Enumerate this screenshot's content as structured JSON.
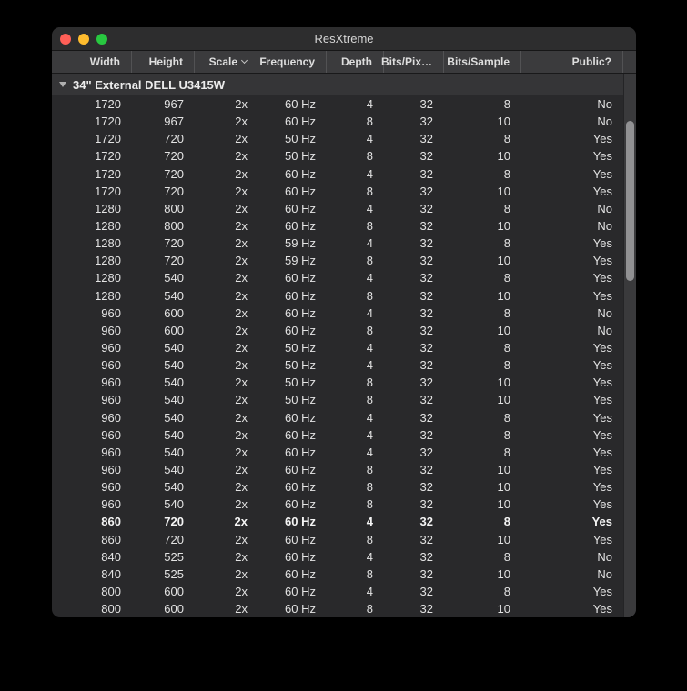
{
  "window": {
    "title": "ResXtreme"
  },
  "titlebar": {
    "traffic_lights": [
      {
        "name": "close",
        "color": "#ff5f57"
      },
      {
        "name": "minimize",
        "color": "#febc2e"
      },
      {
        "name": "zoom",
        "color": "#28c840"
      }
    ]
  },
  "table": {
    "columns": [
      {
        "label": "Width"
      },
      {
        "label": "Height"
      },
      {
        "label": "Scale",
        "sort_indicator": true
      },
      {
        "label": "Frequency"
      },
      {
        "label": "Depth"
      },
      {
        "label": "Bits/Pix…"
      },
      {
        "label": "Bits/Sample"
      },
      {
        "label": "Public?"
      }
    ],
    "group": {
      "label": "34\" External DELL U3415W",
      "expanded": true
    },
    "rows": [
      {
        "cells": [
          "1720",
          "967",
          "2x",
          "60 Hz",
          "4",
          "32",
          "8",
          "No"
        ]
      },
      {
        "cells": [
          "1720",
          "967",
          "2x",
          "60 Hz",
          "8",
          "32",
          "10",
          "No"
        ]
      },
      {
        "cells": [
          "1720",
          "720",
          "2x",
          "50 Hz",
          "4",
          "32",
          "8",
          "Yes"
        ]
      },
      {
        "cells": [
          "1720",
          "720",
          "2x",
          "50 Hz",
          "8",
          "32",
          "10",
          "Yes"
        ]
      },
      {
        "cells": [
          "1720",
          "720",
          "2x",
          "60 Hz",
          "4",
          "32",
          "8",
          "Yes"
        ]
      },
      {
        "cells": [
          "1720",
          "720",
          "2x",
          "60 Hz",
          "8",
          "32",
          "10",
          "Yes"
        ]
      },
      {
        "cells": [
          "1280",
          "800",
          "2x",
          "60 Hz",
          "4",
          "32",
          "8",
          "No"
        ]
      },
      {
        "cells": [
          "1280",
          "800",
          "2x",
          "60 Hz",
          "8",
          "32",
          "10",
          "No"
        ]
      },
      {
        "cells": [
          "1280",
          "720",
          "2x",
          "59 Hz",
          "4",
          "32",
          "8",
          "Yes"
        ]
      },
      {
        "cells": [
          "1280",
          "720",
          "2x",
          "59 Hz",
          "8",
          "32",
          "10",
          "Yes"
        ]
      },
      {
        "cells": [
          "1280",
          "540",
          "2x",
          "60 Hz",
          "4",
          "32",
          "8",
          "Yes"
        ]
      },
      {
        "cells": [
          "1280",
          "540",
          "2x",
          "60 Hz",
          "8",
          "32",
          "10",
          "Yes"
        ]
      },
      {
        "cells": [
          "960",
          "600",
          "2x",
          "60 Hz",
          "4",
          "32",
          "8",
          "No"
        ]
      },
      {
        "cells": [
          "960",
          "600",
          "2x",
          "60 Hz",
          "8",
          "32",
          "10",
          "No"
        ]
      },
      {
        "cells": [
          "960",
          "540",
          "2x",
          "50 Hz",
          "4",
          "32",
          "8",
          "Yes"
        ]
      },
      {
        "cells": [
          "960",
          "540",
          "2x",
          "50 Hz",
          "4",
          "32",
          "8",
          "Yes"
        ]
      },
      {
        "cells": [
          "960",
          "540",
          "2x",
          "50 Hz",
          "8",
          "32",
          "10",
          "Yes"
        ]
      },
      {
        "cells": [
          "960",
          "540",
          "2x",
          "50 Hz",
          "8",
          "32",
          "10",
          "Yes"
        ]
      },
      {
        "cells": [
          "960",
          "540",
          "2x",
          "60 Hz",
          "4",
          "32",
          "8",
          "Yes"
        ]
      },
      {
        "cells": [
          "960",
          "540",
          "2x",
          "60 Hz",
          "4",
          "32",
          "8",
          "Yes"
        ]
      },
      {
        "cells": [
          "960",
          "540",
          "2x",
          "60 Hz",
          "4",
          "32",
          "8",
          "Yes"
        ]
      },
      {
        "cells": [
          "960",
          "540",
          "2x",
          "60 Hz",
          "8",
          "32",
          "10",
          "Yes"
        ]
      },
      {
        "cells": [
          "960",
          "540",
          "2x",
          "60 Hz",
          "8",
          "32",
          "10",
          "Yes"
        ]
      },
      {
        "cells": [
          "960",
          "540",
          "2x",
          "60 Hz",
          "8",
          "32",
          "10",
          "Yes"
        ]
      },
      {
        "cells": [
          "860",
          "720",
          "2x",
          "60 Hz",
          "4",
          "32",
          "8",
          "Yes"
        ],
        "bold": true
      },
      {
        "cells": [
          "860",
          "720",
          "2x",
          "60 Hz",
          "8",
          "32",
          "10",
          "Yes"
        ]
      },
      {
        "cells": [
          "840",
          "525",
          "2x",
          "60 Hz",
          "4",
          "32",
          "8",
          "No"
        ]
      },
      {
        "cells": [
          "840",
          "525",
          "2x",
          "60 Hz",
          "8",
          "32",
          "10",
          "No"
        ]
      },
      {
        "cells": [
          "800",
          "600",
          "2x",
          "60 Hz",
          "4",
          "32",
          "8",
          "Yes"
        ]
      },
      {
        "cells": [
          "800",
          "600",
          "2x",
          "60 Hz",
          "8",
          "32",
          "10",
          "Yes"
        ]
      }
    ]
  }
}
